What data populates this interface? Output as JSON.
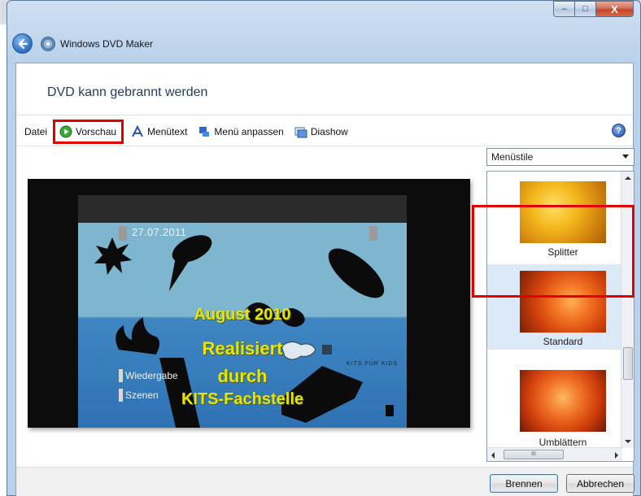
{
  "window": {
    "app_title": "Windows DVD Maker",
    "controls": {
      "minimize": "–",
      "maximize": "□",
      "close": "X"
    }
  },
  "header": {
    "heading": "DVD kann gebrannt werden"
  },
  "toolbar": {
    "file_label": "Datei",
    "preview_label": "Vorschau",
    "menu_text_label": "Menütext",
    "customize_menu_label": "Menü anpassen",
    "slideshow_label": "Diashow",
    "help": "?"
  },
  "preview": {
    "date_overlay": "27.07.2011",
    "title_line1": "August 2010",
    "title_line2": "Realisiert",
    "title_line3": "durch",
    "title_line4": "KITS-Fachstelle",
    "menu_play": "Wiedergabe",
    "menu_scenes": "Szenen",
    "logo_text": "KITS FÜR KIDS"
  },
  "styles_panel": {
    "dropdown_value": "Menüstile",
    "items": [
      {
        "label": "Splitter"
      },
      {
        "label": "Standard"
      },
      {
        "label": "Umblättern"
      }
    ],
    "selected": "Standard",
    "hscroll_grip": "III"
  },
  "footer": {
    "burn_label": "Brennen",
    "cancel_label": "Abbrechen"
  }
}
